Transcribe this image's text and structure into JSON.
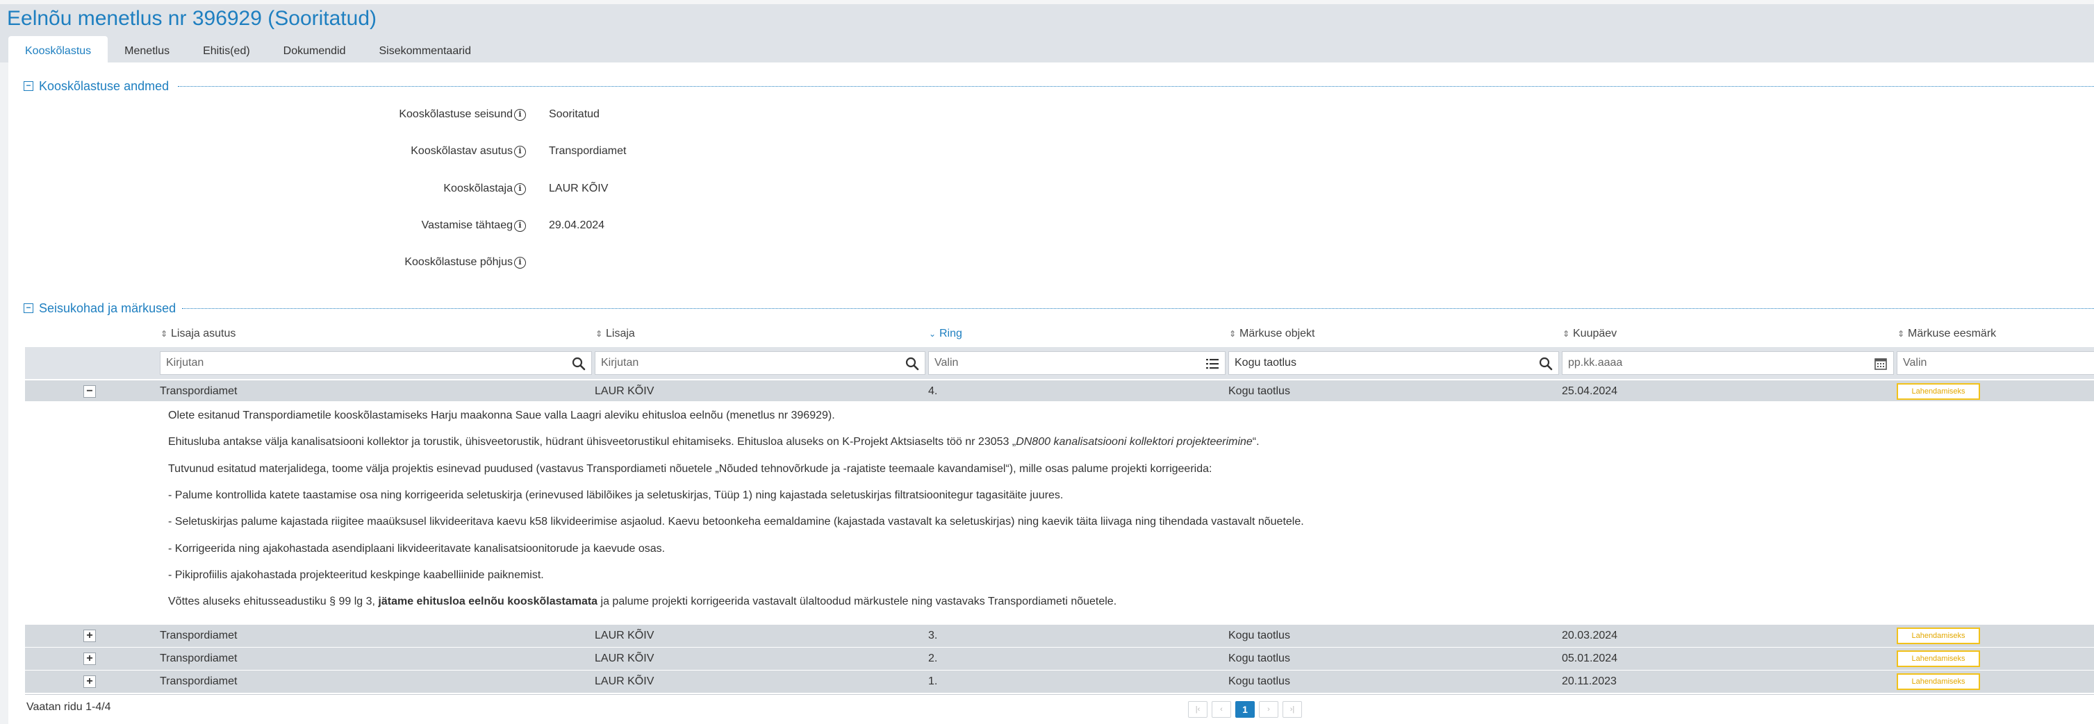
{
  "page": {
    "title": "Eelnõu menetlus nr 396929 (Sooritatud)"
  },
  "tabs": [
    {
      "label": "Kooskõlastus",
      "active": true
    },
    {
      "label": "Menetlus",
      "active": false
    },
    {
      "label": "Ehitis(ed)",
      "active": false
    },
    {
      "label": "Dokumendid",
      "active": false
    },
    {
      "label": "Sisekommentaarid",
      "active": false
    }
  ],
  "approval_section": {
    "title": "Kooskõlastuse andmed",
    "fields": [
      {
        "label": "Kooskõlastuse seisund",
        "value": "Sooritatud"
      },
      {
        "label": "Kooskõlastav asutus",
        "value": "Transpordiamet"
      },
      {
        "label": "Kooskõlastaja",
        "value": "LAUR KÕIV"
      },
      {
        "label": "Vastamise tähtaeg",
        "value": "29.04.2024"
      },
      {
        "label": "Kooskõlastuse põhjus",
        "value": ""
      }
    ]
  },
  "remarks_section": {
    "title": "Seisukohad ja märkused",
    "columns": [
      {
        "label": "Lisaja asutus",
        "sorted": false
      },
      {
        "label": "Lisaja",
        "sorted": false
      },
      {
        "label": "Ring",
        "sorted": true
      },
      {
        "label": "Märkuse objekt",
        "sorted": false
      },
      {
        "label": "Kuupäev",
        "sorted": false
      },
      {
        "label": "Märkuse eesmärk",
        "sorted": false
      }
    ],
    "filters": [
      {
        "placeholder": "Kirjutan",
        "icon": "search-icon"
      },
      {
        "placeholder": "Kirjutan",
        "icon": "search-icon"
      },
      {
        "placeholder": "Valin",
        "icon": "list-icon"
      },
      {
        "placeholder": "",
        "value": "Kogu taotlus",
        "icon": "search-icon"
      },
      {
        "placeholder": "pp.kk.aaaa",
        "icon": "calendar-icon"
      },
      {
        "placeholder": "Valin",
        "icon": ""
      }
    ],
    "rows": [
      {
        "toggle": "−",
        "asutus": "Transpordiamet",
        "lisaja": "LAUR KÕIV",
        "ring": "4.",
        "objekt": "Kogu taotlus",
        "kuupaev": "25.04.2024",
        "eesmark": "Lahendamiseks",
        "expanded": true
      },
      {
        "toggle": "+",
        "asutus": "Transpordiamet",
        "lisaja": "LAUR KÕIV",
        "ring": "3.",
        "objekt": "Kogu taotlus",
        "kuupaev": "20.03.2024",
        "eesmark": "Lahendamiseks",
        "expanded": false
      },
      {
        "toggle": "+",
        "asutus": "Transpordiamet",
        "lisaja": "LAUR KÕIV",
        "ring": "2.",
        "objekt": "Kogu taotlus",
        "kuupaev": "05.01.2024",
        "eesmark": "Lahendamiseks",
        "expanded": false
      },
      {
        "toggle": "+",
        "asutus": "Transpordiamet",
        "lisaja": "LAUR KÕIV",
        "ring": "1.",
        "objekt": "Kogu taotlus",
        "kuupaev": "20.11.2023",
        "eesmark": "Lahendamiseks",
        "expanded": false
      }
    ],
    "detail": {
      "p1": "Olete esitanud Transpordiametile kooskõlastamiseks Harju maakonna Saue valla Laagri aleviku ehitusloa eelnõu (menetlus nr 396929).",
      "p2_start": "Ehitusluba antakse välja kanalisatsiooni kollektor ja torustik, ühisveetorustik, hüdrant ühisveetorustikul ehitamiseks. Ehitusloa aluseks on K-Projekt Aktsiaselts töö nr 23053 „",
      "p2_italic": "DN800 kanalisatsiooni kollektori projekteerimine",
      "p2_end": "“.",
      "p3": "Tutvunud esitatud materjalidega, toome välja projektis esinevad puudused (vastavus Transpordiameti nõuetele „Nõuded tehnovõrkude ja -rajatiste teemaale kavandamisel“), mille osas palume projekti korrigeerida:",
      "b1": "-  Palume kontrollida katete taastamise osa ning korrigeerida seletuskirja (erinevused läbilõikes ja seletuskirjas, Tüüp 1) ning kajastada seletuskirjas filtratsioonitegur tagasitäite juures.",
      "b2": "-  Seletuskirjas palume kajastada riigitee maaüksusel likvideeritava kaevu k58 likvideerimise asjaolud. Kaevu betoonkeha eemaldamine (kajastada vastavalt ka seletuskirjas) ning kaevik täita liivaga ning tihendada vastavalt nõuetele.",
      "b3": "-  Korrigeerida ning ajakohastada asendiplaani likvideeritavate kanalisatsioonitorude ja kaevude osas.",
      "b4": "-  Pikiprofiilis ajakohastada projekteeritud keskpinge kaabelliinide paiknemist.",
      "p4_start": "Võttes aluseks ehitusseadustiku § 99 lg 3, ",
      "p4_bold": "jätame ehitusloa eelnõu kooskõlastamata",
      "p4_end": " ja palume projekti korrigeerida vastavalt ülaltoodud märkustele ning vastavaks Transpordiameti nõuetele."
    }
  },
  "footer": {
    "rows_text": "Vaatan ridu 1-4/4",
    "pager": {
      "first": "|‹",
      "prev": "‹",
      "current": "1",
      "next": "›",
      "last": "›|"
    }
  }
}
